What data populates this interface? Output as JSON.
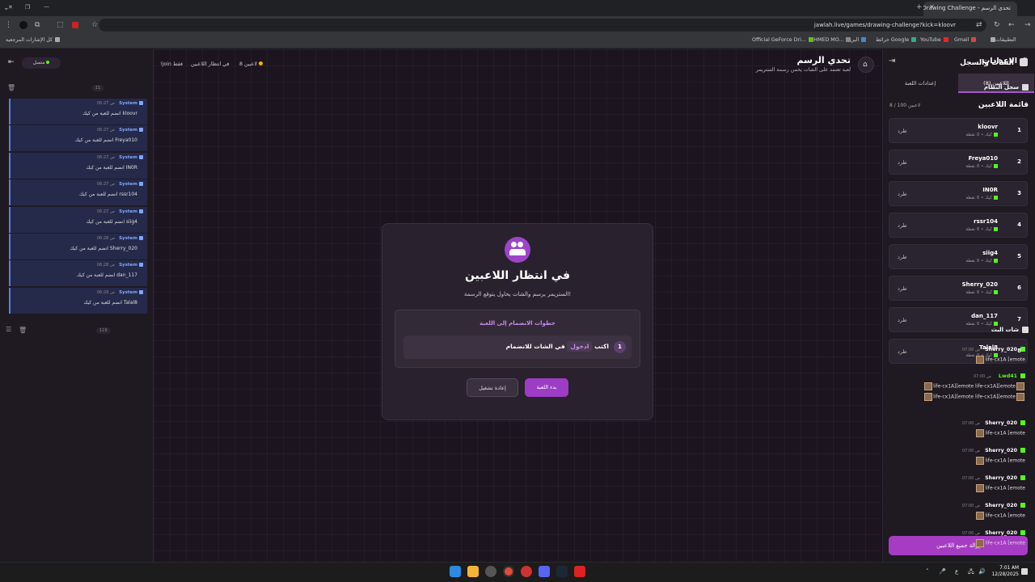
{
  "browser": {
    "tab_title": "تحدي الرسم - Drawing Challenge",
    "url": "jawlah.live/games/drawing-challenge?kick=kloovr",
    "bookmarks": [
      "التطبيقات",
      "Gmail",
      "YouTube",
      "خرائط Google",
      "البريد",
      "AHMED MO...",
      "Official GeForce Dri...",
      "كل الإشارات المرجعية"
    ]
  },
  "header": {
    "title": "تحدي الرسم",
    "subtitle": "لعبة تعتمد على الشات يخمن رسمة الستريمر",
    "players_status": "8 لاعبين",
    "state": "في انتظار اللاعبين",
    "join_only": "!join فقط"
  },
  "right_panel": {
    "title": "الإعدادات",
    "tabs": [
      "اللاعبين (8)",
      "إعدادات اللعبة"
    ],
    "list_title": "قائمة اللاعبين",
    "count": "8 / 100 لاعبين",
    "kick_label": "طرد",
    "players": [
      {
        "num": "1",
        "name": "kloovr",
        "sub": "كيك • 0 نقطة"
      },
      {
        "num": "2",
        "name": "Freya010",
        "sub": "كيك • 0 نقطة"
      },
      {
        "num": "3",
        "name": "IN0R",
        "sub": "كيك • 0 نقطة"
      },
      {
        "num": "4",
        "name": "rssr104",
        "sub": "كيك • 0 نقطة"
      },
      {
        "num": "5",
        "name": "siig4",
        "sub": "كيك • 0 نقطة"
      },
      {
        "num": "6",
        "name": "Sherry_020",
        "sub": "كيك • 0 نقطة"
      },
      {
        "num": "7",
        "name": "dan_117",
        "sub": "كيك • 0 نقطة"
      },
      {
        "num": "8",
        "name": "Talal8",
        "sub": "كيك • 0 نقطة"
      }
    ],
    "remove_all": "إزالة جميع اللاعبين"
  },
  "left_panel": {
    "title": "الشات والسجل",
    "status": "متصل",
    "system_title": "سجل النظام",
    "system_count": "11",
    "system_log": [
      {
        "name": "System",
        "time": "06:27 ص",
        "msg": "kloovr انضم للعبة من كيك"
      },
      {
        "name": "System",
        "time": "06:27 ص",
        "msg": "Freya010 انضم للعبة من كيك"
      },
      {
        "name": "System",
        "time": "06:27 ص",
        "msg": "IN0R انضم للعبة من كيك"
      },
      {
        "name": "System",
        "time": "06:27 ص",
        "msg": "rssr104 انضم للعبة من كيك"
      },
      {
        "name": "System",
        "time": "06:27 ص",
        "msg": "siig4 انضم للعبة من كيك"
      },
      {
        "name": "System",
        "time": "06:28 ص",
        "msg": "Sherry_020 انضم للعبة من كيك"
      },
      {
        "name": "System",
        "time": "06:28 ص",
        "msg": "dan_117 انضم للعبة من كيك"
      },
      {
        "name": "System",
        "time": "06:29 ص",
        "msg": "Talal8 انضم للعبة من كيك"
      }
    ],
    "chat_title": "شات البث",
    "chat_count": "119",
    "chat": [
      {
        "user": "Sherry_020",
        "time": "07:00 ص",
        "msg": "life-cx1A [emote"
      },
      {
        "user": "Lwd41",
        "time": "07:00 ص",
        "msg": "life-cx1A][emote life-cx1A][emote"
      },
      {
        "user": "Sherry_020",
        "time": "07:00 ص",
        "msg": "life-cx1A [emote"
      },
      {
        "user": "Sherry_020",
        "time": "07:00 ص",
        "msg": "life-cx1A [emote"
      },
      {
        "user": "Sherry_020",
        "time": "07:00 ص",
        "msg": "life-cx1A [emote"
      },
      {
        "user": "Sherry_020",
        "time": "07:00 ص",
        "msg": "life-cx1A [emote"
      },
      {
        "user": "Sherry_020",
        "time": "07:00 ص",
        "msg": "life-cx1A [emote"
      }
    ]
  },
  "modal": {
    "title": "في انتظار اللاعبين",
    "subtitle": "الستريمر يرسم والشات يحاول يتوقع الرسمة!",
    "steps_title": "خطوات الانضمام إلى اللعبة",
    "step_num": "1",
    "step_before": "اكتب",
    "step_keyword": "ادخول",
    "step_after": "في الشات للانضمام",
    "start": "بدء اللعبة",
    "restart": "إعادة تشغيل"
  },
  "taskbar": {
    "time": "7:01 AM",
    "date": "12/28/2025",
    "lang": "ع"
  }
}
